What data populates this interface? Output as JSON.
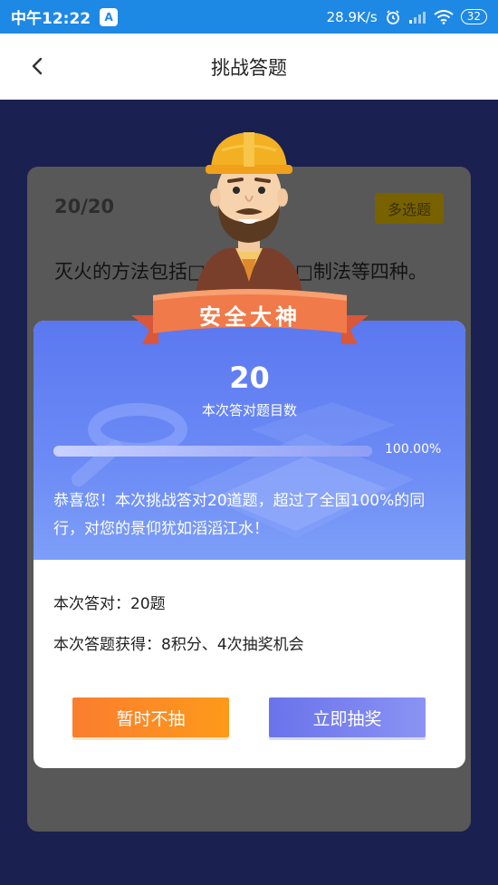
{
  "status_bar": {
    "time": "中午12:22",
    "app_icon": "A",
    "network_speed": "28.9K/s",
    "battery": "32",
    "icons": [
      "alarm-icon",
      "signal-icon",
      "wifi-icon"
    ]
  },
  "nav": {
    "title": "挑战答题",
    "back_icon": "chevron-left-icon"
  },
  "quiz": {
    "number": "20/20",
    "type": "多选题",
    "question": "灭火的方法包括□□□□□□□制法等四种。"
  },
  "result": {
    "badge_title": "安全大神",
    "score": "20",
    "score_label": "本次答对题目数",
    "progress_fraction": 1.0,
    "progress_text": "100.00%",
    "congrats": "恭喜您！本次挑战答对20道题，超过了全国100%的同行，对您的景仰犹如滔滔江水！",
    "correct_line": "本次答对：20题",
    "reward_line": "本次答题获得：8积分、4次抽奖机会",
    "skip_button": "暂时不抽",
    "draw_button": "立即抽奖"
  },
  "colors": {
    "status_bar": "#1e88e5",
    "background": "#1b2150",
    "dialog_top": "#6c8bf5",
    "skip_button": "#fb7d2f",
    "draw_button": "#6a73ea",
    "ribbon": "#f07a4a"
  }
}
